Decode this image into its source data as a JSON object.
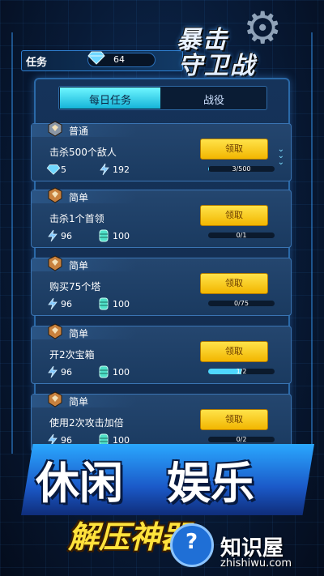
{
  "header": {
    "title": "任务",
    "gem_count": "64"
  },
  "logo": {
    "line1": "暴击",
    "line2": "守卫战"
  },
  "tabs": {
    "active_label": "每日任务",
    "other_label": "战役"
  },
  "tasks": [
    {
      "rank": "普通",
      "title": "击杀500个敌人",
      "reward1": "5",
      "reward1_icon": "gem-icon",
      "reward2": "192",
      "reward2_icon": "lightning-icon",
      "button": "领取",
      "progress_text": "3/500",
      "progress": 0.006
    },
    {
      "rank": "简单",
      "title": "击杀1个首领",
      "reward1": "96",
      "reward1_icon": "lightning-icon",
      "reward2": "100",
      "reward2_icon": "barrel-icon",
      "button": "领取",
      "progress_text": "0/1",
      "progress": 0
    },
    {
      "rank": "简单",
      "title": "购买75个塔",
      "reward1": "96",
      "reward1_icon": "lightning-icon",
      "reward2": "100",
      "reward2_icon": "barrel-icon",
      "button": "领取",
      "progress_text": "0/75",
      "progress": 0
    },
    {
      "rank": "简单",
      "title": "开2次宝箱",
      "reward1": "96",
      "reward1_icon": "lightning-icon",
      "reward2": "100",
      "reward2_icon": "barrel-icon",
      "button": "领取",
      "progress_text": "1/2",
      "progress": 0.5
    },
    {
      "rank": "简单",
      "title": "使用2次攻击加倍",
      "reward1": "96",
      "reward1_icon": "lightning-icon",
      "reward2": "100",
      "reward2_icon": "barrel-icon",
      "button": "领取",
      "progress_text": "0/2",
      "progress": 0
    }
  ],
  "promo": {
    "big1": "休闲",
    "big2": "娱乐",
    "small": "解压神器"
  },
  "watermark": {
    "text": "知识屋",
    "url": "zhishiwu.com"
  },
  "colors": {
    "accent_cyan": "#4fd7ff",
    "button_yellow": "#ffd21c",
    "panel_blue": "#15335a"
  }
}
